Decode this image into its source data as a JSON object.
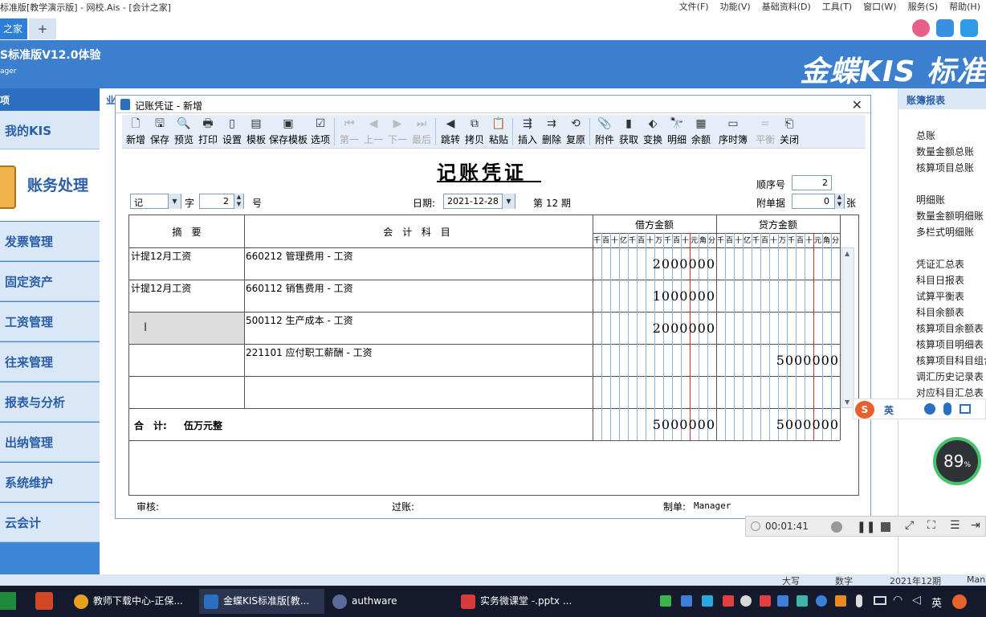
{
  "window": {
    "title": "标准版[教学演示版] - 网校.Ais - [会计之家]"
  },
  "menu": [
    "文件(F)",
    "功能(V)",
    "基础资料(D)",
    "工具(T)",
    "窗口(W)",
    "服务(S)",
    "帮助(H)"
  ],
  "tabs": {
    "active": "之家",
    "plus": "+"
  },
  "banner": {
    "version": "S标准版V12.0体验",
    "user": "ager",
    "brand": "金蝶KIS 标准"
  },
  "left_panel": {
    "header": "项",
    "my_kis": "我的KIS",
    "accounting": "账务处理",
    "items": [
      "发票管理",
      "固定资产",
      "工资管理",
      "往来管理",
      "报表与分析",
      "出纳管理",
      "系统维护",
      "云会计"
    ]
  },
  "mid_header": "业",
  "right_panel": {
    "header": "账簿报表",
    "group1": [
      "总账",
      "数量金额总账",
      "核算项目总账"
    ],
    "group2": [
      "明细账",
      "数量金额明细账",
      "多栏式明细账"
    ],
    "group3": [
      "凭证汇总表",
      "科目日报表",
      "试算平衡表",
      "科目余额表",
      "核算项目余额表",
      "核算项目明细表",
      "核算项目科目组合",
      "调汇历史记录表",
      "对应科目汇总表"
    ]
  },
  "dialog": {
    "title": "记账凭证 - 新增",
    "close": "✕",
    "toolbar": [
      {
        "label": "新增",
        "glyph": "🗋",
        "enabled": true
      },
      {
        "label": "保存",
        "glyph": "🖫",
        "enabled": true
      },
      {
        "label": "预览",
        "glyph": "🔍",
        "enabled": true
      },
      {
        "label": "打印",
        "glyph": "🖶",
        "enabled": true
      },
      {
        "label": "设置",
        "glyph": "▯",
        "enabled": true
      },
      {
        "label": "模板",
        "glyph": "▤",
        "enabled": true
      },
      {
        "label": "保存模板",
        "glyph": "▣",
        "enabled": true
      },
      {
        "label": "选项",
        "glyph": "☑",
        "enabled": true
      },
      {
        "label": "第一",
        "glyph": "⏮",
        "enabled": false
      },
      {
        "label": "上一",
        "glyph": "◀",
        "enabled": false
      },
      {
        "label": "下一",
        "glyph": "▶",
        "enabled": false
      },
      {
        "label": "最后",
        "glyph": "⏭",
        "enabled": false
      },
      {
        "label": "跳转",
        "glyph": "◀",
        "enabled": true
      },
      {
        "label": "拷贝",
        "glyph": "⧉",
        "enabled": true
      },
      {
        "label": "粘贴",
        "glyph": "📋",
        "enabled": true
      },
      {
        "label": "插入",
        "glyph": "⇶",
        "enabled": true
      },
      {
        "label": "删除",
        "glyph": "⇉",
        "enabled": true
      },
      {
        "label": "复原",
        "glyph": "⟲",
        "enabled": true
      },
      {
        "label": "附件",
        "glyph": "📎",
        "enabled": true
      },
      {
        "label": "获取",
        "glyph": "▮",
        "enabled": true
      },
      {
        "label": "变换",
        "glyph": "⬖",
        "enabled": true
      },
      {
        "label": "明细",
        "glyph": "🔭",
        "enabled": true
      },
      {
        "label": "余额",
        "glyph": "▦",
        "enabled": true
      },
      {
        "label": "序时簿",
        "glyph": "▭",
        "enabled": true
      },
      {
        "label": "平衡",
        "glyph": "=",
        "enabled": false
      },
      {
        "label": "关闭",
        "glyph": "⎗",
        "enabled": true
      }
    ],
    "voucher_title": "记账凭证",
    "seq_label": "顺序号",
    "seq_value": "2",
    "word_value": "记",
    "word_label": "字",
    "number_value": "2",
    "number_label": "号",
    "date_label": "日期:",
    "date_value": "2021-12-28",
    "period_text": "第 12 期",
    "attach_label": "附单据",
    "attach_value": "0",
    "attach_unit": "张",
    "col_summary": "摘　要",
    "col_account": "会 计 科 目",
    "col_debit": "借方金额",
    "col_credit": "贷方金额",
    "digit_units": [
      "千",
      "百",
      "十",
      "亿",
      "千",
      "百",
      "十",
      "万",
      "千",
      "百",
      "十",
      "元",
      "角",
      "分"
    ],
    "rows": [
      {
        "summary": "计提12月工资",
        "account": "660212 管理费用 - 工资",
        "debit": "2000000",
        "credit": ""
      },
      {
        "summary": "计提12月工资",
        "account": "660112 销售费用 - 工资",
        "debit": "1000000",
        "credit": ""
      },
      {
        "summary": "",
        "account": "500112 生产成本 - 工资",
        "debit": "2000000",
        "credit": ""
      },
      {
        "summary": "",
        "account": "221101 应付职工薪酬 - 工资",
        "debit": "",
        "credit": "5000000"
      },
      {
        "summary": "",
        "account": "",
        "debit": "",
        "credit": ""
      }
    ],
    "total_label": "合　计:",
    "total_words": "伍万元整",
    "total_debit": "5000000",
    "total_credit": "5000000",
    "audit_label": "审核:",
    "post_label": "过账:",
    "maker_label": "制单:",
    "maker_value": "Manager"
  },
  "status": {
    "case": "大写",
    "num": "数字",
    "period": "2021年12期",
    "user": "Mana"
  },
  "recorder": {
    "time": "00:01:41"
  },
  "gauge": {
    "value": "89",
    "unit": "%"
  },
  "ime": {
    "lang": "英"
  },
  "taskbar": {
    "items": [
      "教师下载中心-正保...",
      "金蝶KIS标准版[教...",
      "authware",
      "实务微课堂 -.pptx ..."
    ],
    "lang": "英"
  },
  "colors": {
    "brand_blue": "#3d7fcf",
    "nav_text": "#2a5ea8",
    "red_line": "#d83030"
  }
}
